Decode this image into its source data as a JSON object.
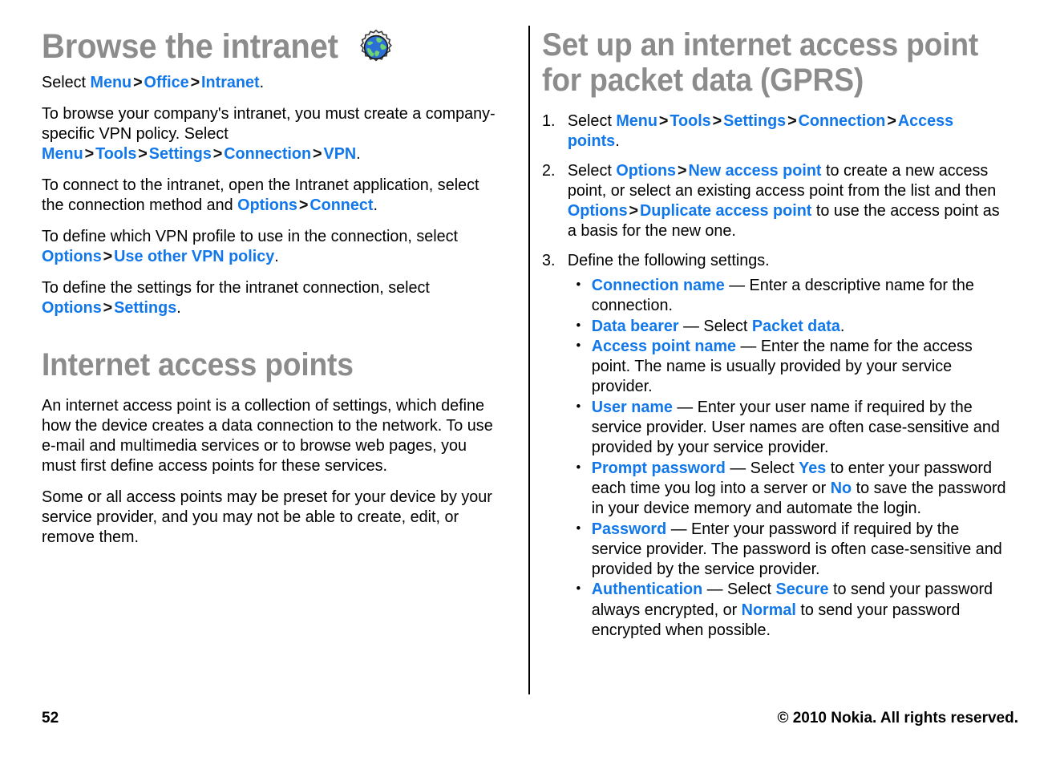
{
  "page": {
    "number": "52",
    "copyright": "© 2010 Nokia. All rights reserved.",
    "accent_color": "#1278ea",
    "heading_color": "#8c8c8c"
  },
  "left_column": {
    "heading": "Browse the intranet",
    "heading_icon": "globe-gear-icon",
    "paragraph_1": {
      "t1": "Select ",
      "ui1": "Menu",
      "s1": ">",
      "ui2": "Office",
      "s2": ">",
      "ui3": "Intranet",
      "t2": "."
    },
    "paragraph_2": {
      "t1": "To browse your company's intranet, you must create a company-specific VPN policy. Select ",
      "ui1": "Menu",
      "s1": ">",
      "ui2": "Tools",
      "s2": ">",
      "ui3": "Settings",
      "s3": ">",
      "ui4": "Connection",
      "s4": ">",
      "ui5": "VPN",
      "t2": "."
    },
    "paragraph_3": {
      "t1": "To connect to the intranet, open the Intranet application, select the connection method and ",
      "ui1": "Options",
      "s1": ">",
      "ui2": "Connect",
      "t2": "."
    },
    "paragraph_4": {
      "t1": "To define which VPN profile to use in the connection, select ",
      "ui1": "Options",
      "s1": ">",
      "ui2": "Use other VPN policy",
      "t2": "."
    },
    "paragraph_5": {
      "t1": "To define the settings for the intranet connection, select ",
      "ui1": "Options",
      "s1": ">",
      "ui2": "Settings",
      "t2": "."
    },
    "section_heading": "Internet access points",
    "paragraph_6": "An internet access point is a collection of settings, which define how the device creates a data connection to the network. To use e-mail and multimedia services or to browse web pages, you must first define access points for these services.",
    "paragraph_7": "Some or all access points may be preset for your device by your service provider, and you may not be able to create, edit, or remove them."
  },
  "right_column": {
    "heading": "Set up an internet access point for packet data (GPRS)",
    "steps": [
      {
        "num": "1.",
        "parts": {
          "t1": "Select ",
          "ui1": "Menu",
          "s1": ">",
          "ui2": "Tools",
          "s2": ">",
          "ui3": "Settings",
          "s3": ">",
          "ui4": "Connection",
          "s4": ">",
          "ui5": "Access points",
          "t2": "."
        }
      },
      {
        "num": "2.",
        "parts": {
          "t1": "Select ",
          "ui1": "Options",
          "s1": ">",
          "ui2": "New access point",
          "t2": " to create a new access point, or select an existing access point from the list and then ",
          "ui3": "Options",
          "s2": ">",
          "ui4": "Duplicate access point",
          "t3": " to use the access point as a basis for the new one."
        }
      },
      {
        "num": "3.",
        "parts": {
          "t1": "Define the following settings."
        }
      }
    ],
    "bullets": [
      {
        "term": "Connection name",
        "dash": " — ",
        "t1": "Enter a descriptive name for the connection."
      },
      {
        "term": "Data bearer",
        "dash": " — ",
        "t1": "Select ",
        "ui1": "Packet data",
        "t2": "."
      },
      {
        "term": "Access point name",
        "dash": " — ",
        "t1": "Enter the name for the access point. The name is usually provided by your service provider."
      },
      {
        "term": "User name",
        "dash": " — ",
        "t1": "Enter your user name if required by the service provider. User names are often case-sensitive and provided by your service provider."
      },
      {
        "term": "Prompt password",
        "dash": " — ",
        "t1": "Select ",
        "ui1": "Yes",
        "t2": " to enter your password each time you log into a server or ",
        "ui2": "No",
        "t3": " to save the password in your device memory and automate the login."
      },
      {
        "term": "Password",
        "dash": " — ",
        "t1": "Enter your password if required by the service provider. The password is often case-sensitive and provided by the service provider."
      },
      {
        "term": "Authentication",
        "dash": " — ",
        "t1": "Select ",
        "ui1": "Secure",
        "t2": " to send your password always encrypted, or ",
        "ui2": "Normal",
        "t3": " to send your password encrypted when possible."
      }
    ]
  }
}
